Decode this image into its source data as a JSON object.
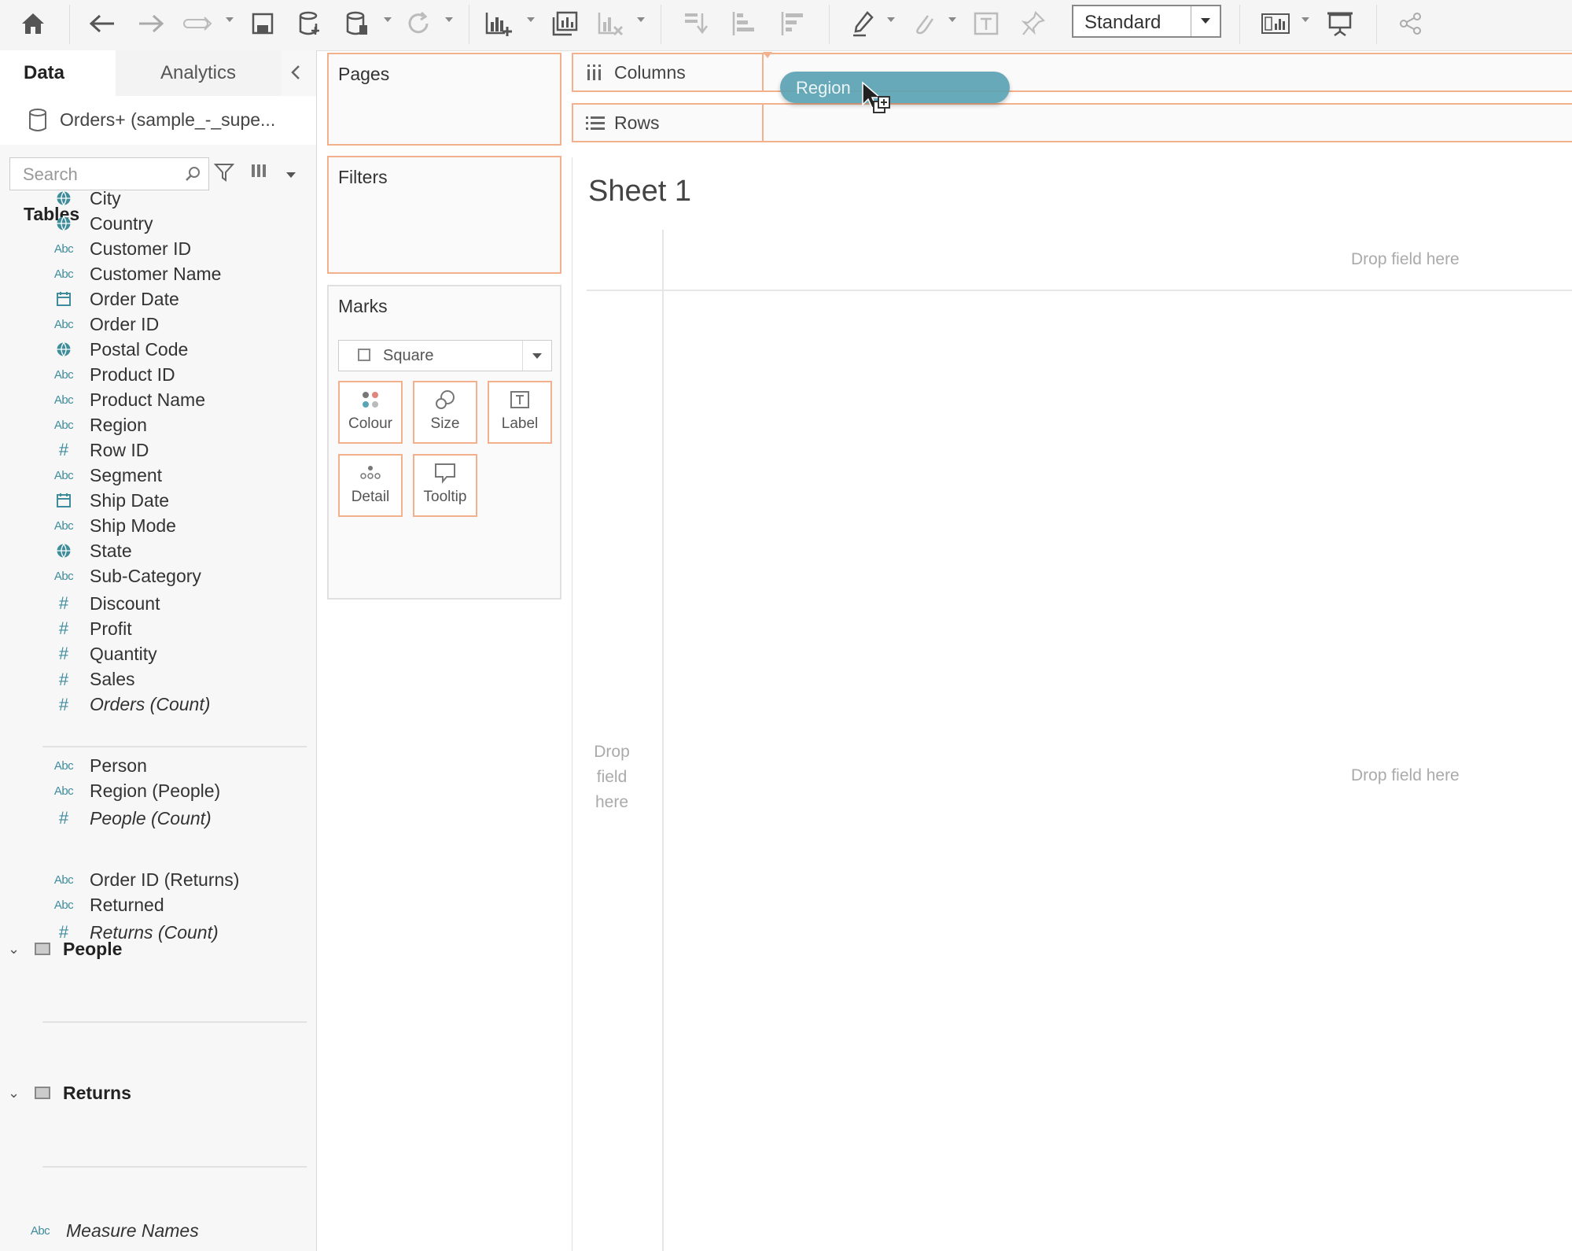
{
  "toolbar": {
    "view_select": "Standard",
    "colors": {
      "pane_bg": "#f7f7f7",
      "shelf_border": "#f2b08c",
      "pill": "#5ba3b4",
      "field_icon": "#3e8c9c"
    }
  },
  "sidebar": {
    "tabs": [
      "Data",
      "Analytics"
    ],
    "datasource": "Orders+ (sample_-_supe...",
    "search": {
      "placeholder": "Search",
      "value": ""
    },
    "tables_heading": "Tables",
    "orders_dimensions": [
      {
        "icon": "globe",
        "label": "City"
      },
      {
        "icon": "globe",
        "label": "Country"
      },
      {
        "icon": "Abc",
        "label": "Customer ID"
      },
      {
        "icon": "Abc",
        "label": "Customer Name"
      },
      {
        "icon": "calendar",
        "label": "Order Date"
      },
      {
        "icon": "Abc",
        "label": "Order ID"
      },
      {
        "icon": "globe",
        "label": "Postal Code"
      },
      {
        "icon": "Abc",
        "label": "Product ID"
      },
      {
        "icon": "Abc",
        "label": "Product Name"
      },
      {
        "icon": "Abc",
        "label": "Region"
      },
      {
        "icon": "#",
        "label": "Row ID"
      },
      {
        "icon": "Abc",
        "label": "Segment"
      },
      {
        "icon": "calendar",
        "label": "Ship Date"
      },
      {
        "icon": "Abc",
        "label": "Ship Mode"
      },
      {
        "icon": "globe",
        "label": "State"
      },
      {
        "icon": "Abc",
        "label": "Sub-Category"
      }
    ],
    "orders_measures": [
      {
        "icon": "#",
        "label": "Discount"
      },
      {
        "icon": "#",
        "label": "Profit"
      },
      {
        "icon": "#",
        "label": "Quantity"
      },
      {
        "icon": "#",
        "label": "Sales"
      },
      {
        "icon": "#",
        "label": "Orders (Count)"
      }
    ],
    "people": {
      "title": "People",
      "fields": [
        {
          "icon": "Abc",
          "label": "Person"
        },
        {
          "icon": "Abc",
          "label": "Region (People)"
        },
        {
          "icon": "#",
          "label": "People (Count)"
        }
      ]
    },
    "returns": {
      "title": "Returns",
      "fields": [
        {
          "icon": "Abc",
          "label": "Order ID (Returns)"
        },
        {
          "icon": "Abc",
          "label": "Returned"
        },
        {
          "icon": "#",
          "label": "Returns (Count)"
        }
      ]
    },
    "measure_names": {
      "icon": "Abc",
      "label": "Measure Names"
    }
  },
  "cards": {
    "pages": "Pages",
    "filters": "Filters",
    "marks": {
      "title": "Marks",
      "mark_type": "Square",
      "buttons": [
        "Colour",
        "Size",
        "Label",
        "Detail",
        "Tooltip"
      ]
    }
  },
  "shelves": {
    "columns": "Columns",
    "rows": "Rows",
    "dragging_pill": "Region"
  },
  "canvas": {
    "sheet_title": "Sheet 1",
    "drop_hint": "Drop field here",
    "row_drop_hint": [
      "Drop",
      "field",
      "here"
    ]
  }
}
